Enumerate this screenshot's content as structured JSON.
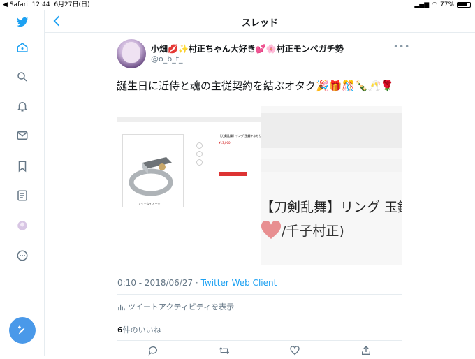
{
  "status": {
    "back_app": "◀ Safari",
    "time": "12:44",
    "date": "6月27日(日)",
    "battery": "77%"
  },
  "header": {
    "title": "スレッド"
  },
  "tweet": {
    "display_name": "小畑💋✨村正ちゃん大好き💕🌸村正モンペガチ勢",
    "username": "@o_b_t_",
    "text": "誕生日に近侍と魂の主従契約を結ぶオタク🎉🎁🎊🍾🥂🌹",
    "time": "0:10",
    "separator": "·",
    "date": "2018/06/27",
    "client": "Twitter Web Client",
    "activity_label": "ツイートアクティビティを表示",
    "like_count": "6",
    "like_label": "件のいいね"
  },
  "media": {
    "left_caption": "アイテムイメージ",
    "product_title": "【刀剣乱舞】リング 玉鋼＋ふもり",
    "price": "¥13,000",
    "big_title": "【刀剣乱舞】リング 玉鋼",
    "big_sub": "/千子村正)"
  },
  "colors": {
    "accent": "#1da1f2",
    "compose": "#4a99e9",
    "border": "#e6ecf0"
  }
}
